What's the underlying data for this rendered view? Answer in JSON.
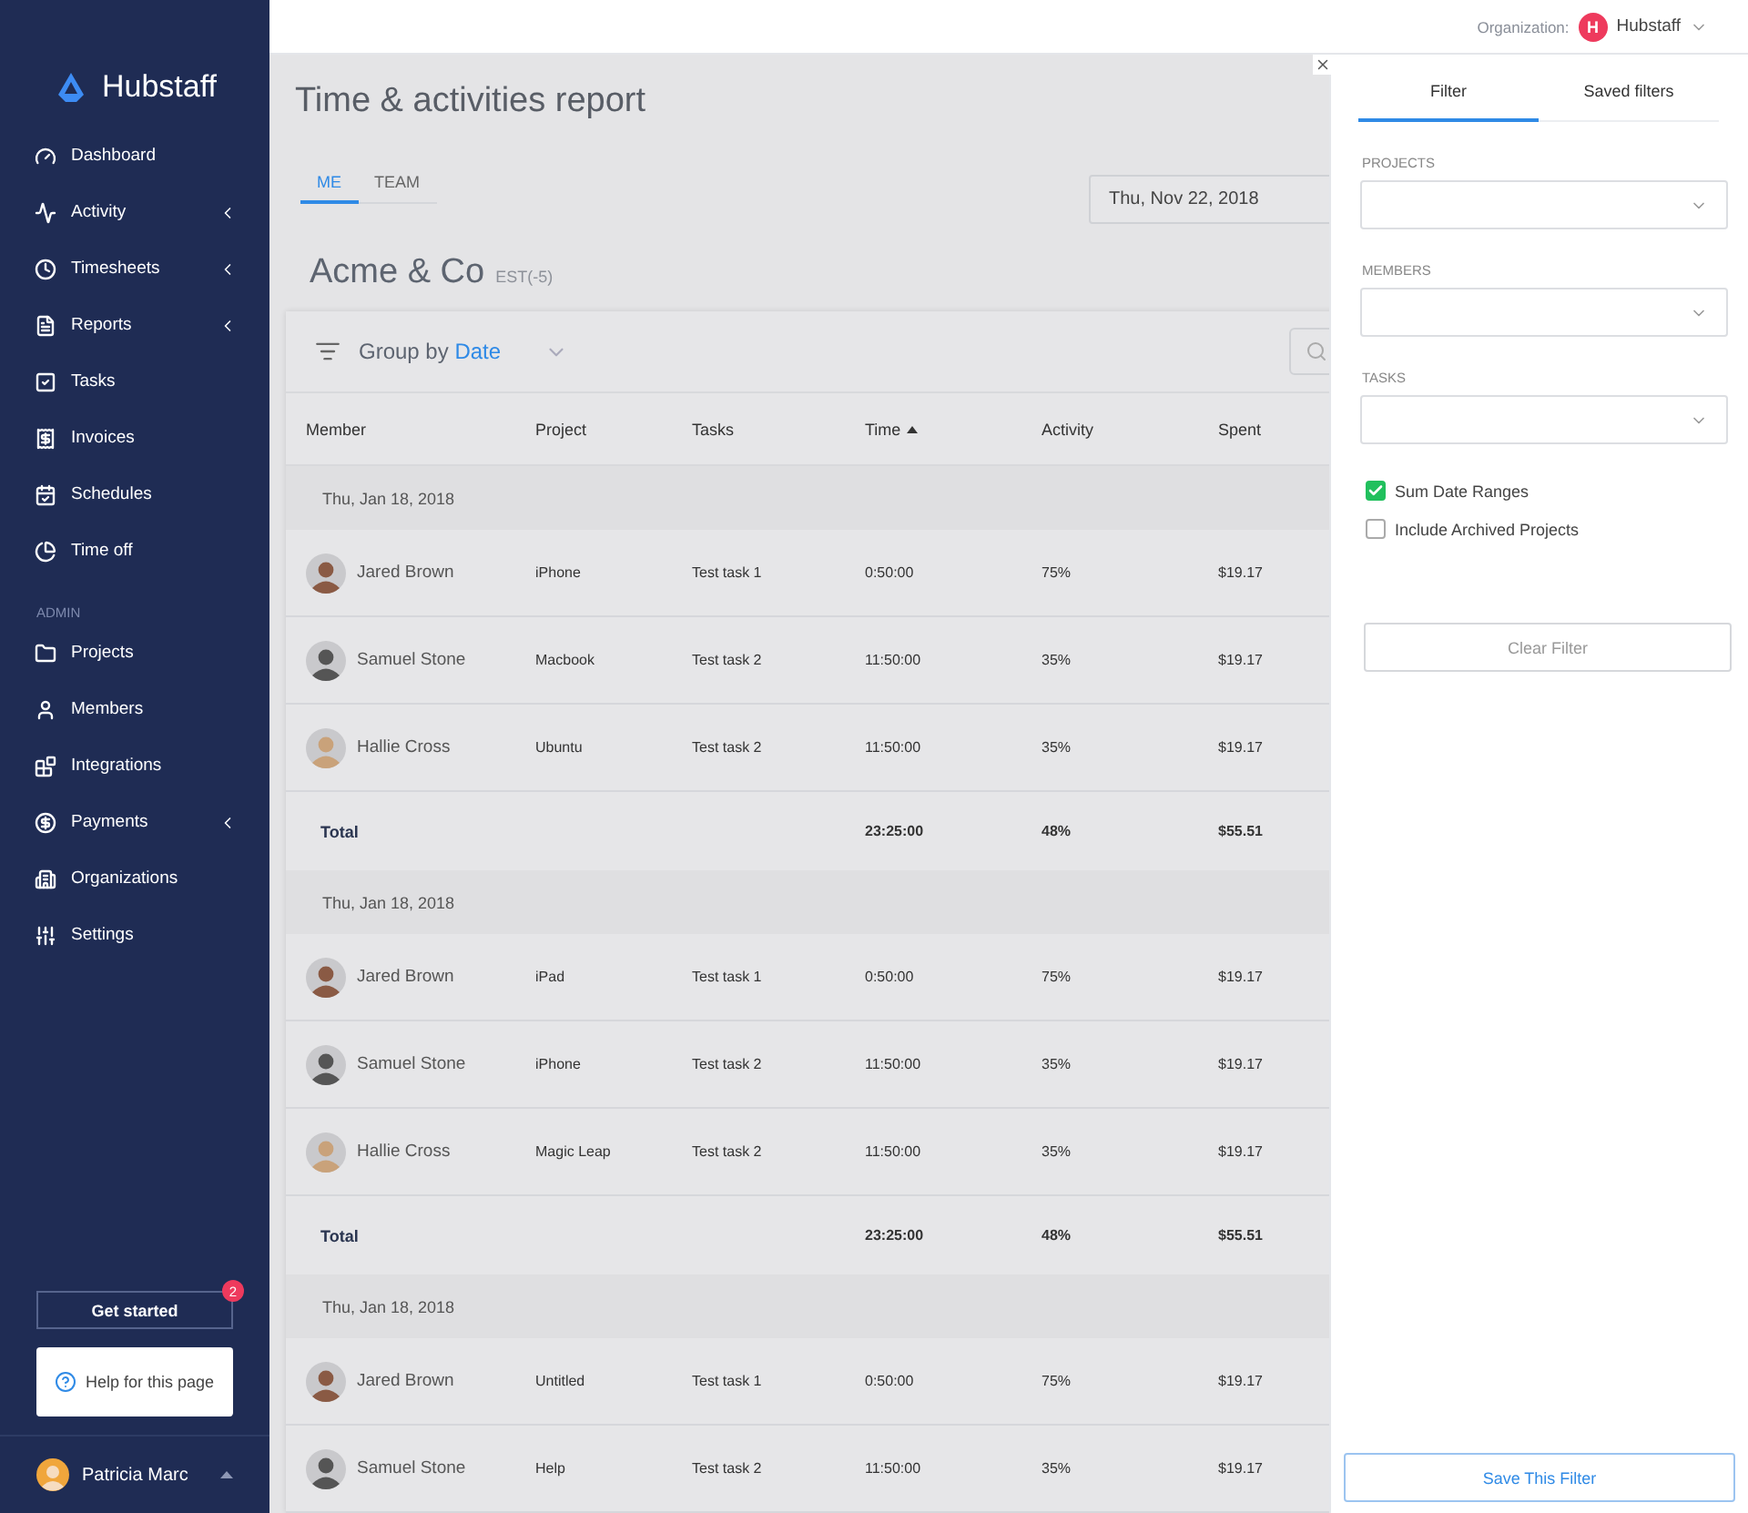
{
  "sidebar": {
    "logo": "Hubstaff",
    "items": [
      {
        "label": "Dashboard",
        "has_submenu": false
      },
      {
        "label": "Activity",
        "has_submenu": true
      },
      {
        "label": "Timesheets",
        "has_submenu": true
      },
      {
        "label": "Reports",
        "has_submenu": true
      },
      {
        "label": "Tasks",
        "has_submenu": false
      },
      {
        "label": "Invoices",
        "has_submenu": false
      },
      {
        "label": "Schedules",
        "has_submenu": false
      },
      {
        "label": "Time off",
        "has_submenu": false
      }
    ],
    "section_label": "ADMIN",
    "admin_items": [
      {
        "label": "Projects",
        "has_submenu": false
      },
      {
        "label": "Members",
        "has_submenu": false
      },
      {
        "label": "Integrations",
        "has_submenu": false
      },
      {
        "label": "Payments",
        "has_submenu": true
      },
      {
        "label": "Organizations",
        "has_submenu": false
      },
      {
        "label": "Settings",
        "has_submenu": false
      }
    ],
    "get_started": {
      "label": "Get started",
      "badge": "2"
    },
    "help": "Help for this page",
    "user": {
      "name": "Patricia Marc"
    }
  },
  "top_bar": {
    "org_label": "Organization:",
    "org_initial": "H",
    "org_name": "Hubstaff"
  },
  "report": {
    "title": "Time & activities report",
    "tabs": [
      {
        "label": "ME",
        "selected": true
      },
      {
        "label": "TEAM",
        "selected": false
      }
    ],
    "date": "Thu, Nov 22, 2018",
    "company": "Acme & Co",
    "timezone": "EST(-5)",
    "group_by": {
      "label": "Group by",
      "value": "Date"
    },
    "columns": [
      {
        "label": "Member",
        "sorted": false
      },
      {
        "label": "Project",
        "sorted": false
      },
      {
        "label": "Tasks",
        "sorted": false
      },
      {
        "label": "Time",
        "sorted": true
      },
      {
        "label": "Activity",
        "sorted": false
      },
      {
        "label": "Spent",
        "sorted": false
      }
    ],
    "groups": [
      {
        "date": "Thu, Jan 18, 2018",
        "rows": [
          {
            "member": "Jared Brown",
            "project": "iPhone",
            "task": "Test task 1",
            "time": "0:50:00",
            "activity": "75%",
            "spent": "$19.17"
          },
          {
            "member": "Samuel Stone",
            "project": "Macbook",
            "task": "Test task 2",
            "time": "11:50:00",
            "activity": "35%",
            "spent": "$19.17"
          },
          {
            "member": "Hallie Cross",
            "project": "Ubuntu",
            "task": "Test task 2",
            "time": "11:50:00",
            "activity": "35%",
            "spent": "$19.17"
          }
        ],
        "total": {
          "label": "Total",
          "time": "23:25:00",
          "activity": "48%",
          "spent": "$55.51"
        }
      },
      {
        "date": "Thu, Jan 18, 2018",
        "rows": [
          {
            "member": "Jared Brown",
            "project": "iPad",
            "task": "Test task 1",
            "time": "0:50:00",
            "activity": "75%",
            "spent": "$19.17"
          },
          {
            "member": "Samuel Stone",
            "project": "iPhone",
            "task": "Test task 2",
            "time": "11:50:00",
            "activity": "35%",
            "spent": "$19.17"
          },
          {
            "member": "Hallie Cross",
            "project": "Magic Leap",
            "task": "Test task 2",
            "time": "11:50:00",
            "activity": "35%",
            "spent": "$19.17"
          }
        ],
        "total": {
          "label": "Total",
          "time": "23:25:00",
          "activity": "48%",
          "spent": "$55.51"
        }
      },
      {
        "date": "Thu, Jan 18, 2018",
        "rows": [
          {
            "member": "Jared Brown",
            "project": "Untitled",
            "task": "Test task 1",
            "time": "0:50:00",
            "activity": "75%",
            "spent": "$19.17"
          },
          {
            "member": "Samuel Stone",
            "project": "Help",
            "task": "Test task 2",
            "time": "11:50:00",
            "activity": "35%",
            "spent": "$19.17"
          }
        ]
      }
    ]
  },
  "filter_panel": {
    "tabs": [
      {
        "label": "Filter",
        "selected": true
      },
      {
        "label": "Saved filters",
        "selected": false
      }
    ],
    "fields": [
      {
        "label": "PROJECTS"
      },
      {
        "label": "MEMBERS"
      },
      {
        "label": "TASKS"
      }
    ],
    "checkboxes": [
      {
        "label": "Sum Date Ranges",
        "checked": true
      },
      {
        "label": "Include Archived Projects",
        "checked": false
      }
    ],
    "clear_button": "Clear Filter",
    "save_button": "Save This Filter"
  }
}
